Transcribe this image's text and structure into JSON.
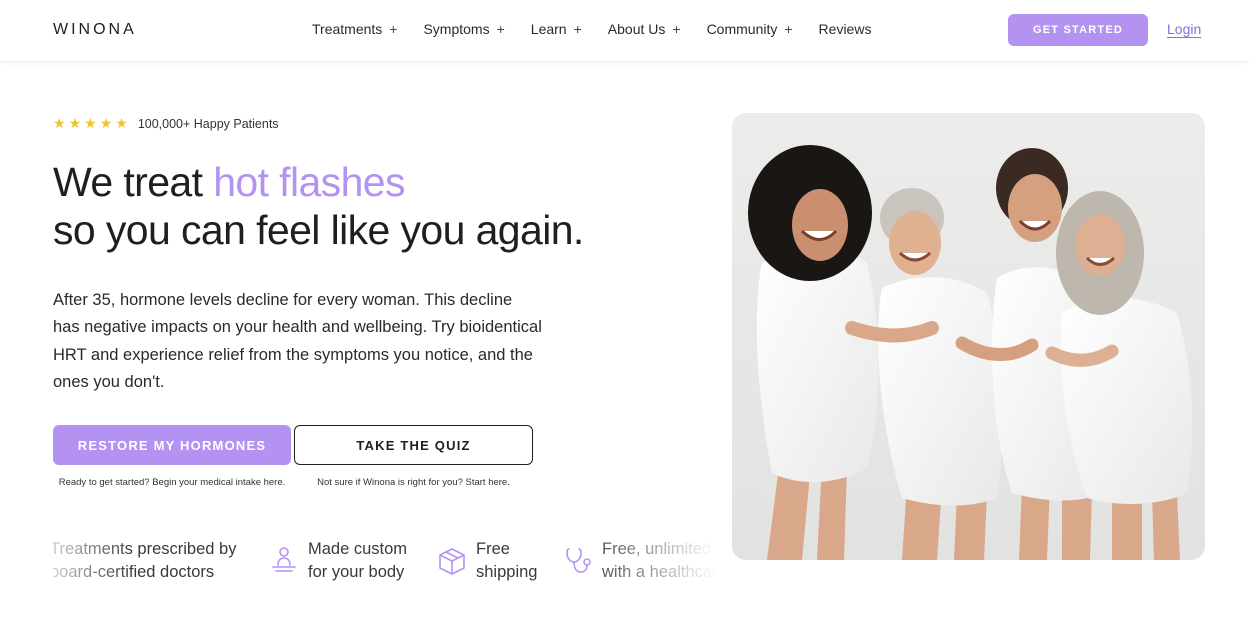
{
  "header": {
    "logo": "WINONA",
    "nav": [
      {
        "label": "Treatments",
        "has_submenu": true
      },
      {
        "label": "Symptoms",
        "has_submenu": true
      },
      {
        "label": "Learn",
        "has_submenu": true
      },
      {
        "label": "About Us",
        "has_submenu": true
      },
      {
        "label": "Community",
        "has_submenu": true
      },
      {
        "label": "Reviews",
        "has_submenu": false
      }
    ],
    "submenu_symbol": "+",
    "get_started_label": "GET STARTED",
    "login_label": "Login"
  },
  "hero": {
    "rating": {
      "stars": 5,
      "star_glyph": "★",
      "text": "100,000+ Happy Patients"
    },
    "headline_prefix": "We treat ",
    "headline_accent": "hot flashes",
    "headline_line2": "so you can feel like you again.",
    "intro": "After 35, hormone levels decline for every woman. This decline has negative impacts on your health and wellbeing. Try bioidentical HRT and experience relief from the symptoms you notice, and the ones you don't.",
    "primary_cta": "RESTORE MY HORMONES",
    "primary_note": "Ready to get started? Begin your medical intake here.",
    "secondary_cta": "TAKE THE QUIZ",
    "secondary_note": "Not sure if Winona is right for you? Start here."
  },
  "features": [
    {
      "icon": "doctor-icon",
      "line1": "Treatments prescribed by",
      "line2": "board-certified doctors"
    },
    {
      "icon": "body-icon",
      "line1": "Made custom",
      "line2": "for your body"
    },
    {
      "icon": "box-icon",
      "line1": "Free",
      "line2": "shipping"
    },
    {
      "icon": "stethoscope-icon",
      "line1": "Free, unlimited",
      "line2": "with a healthcare"
    }
  ],
  "colors": {
    "accent": "#b492f2",
    "link": "#8a6be0",
    "star": "#f2c12e",
    "text": "#1f1f1f"
  }
}
